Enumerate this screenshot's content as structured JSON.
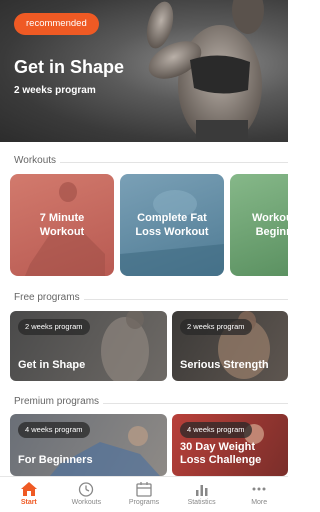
{
  "hero": {
    "badge": "recommended",
    "title": "Get in Shape",
    "subtitle": "2 weeks program"
  },
  "sections": {
    "workouts": "Workouts",
    "free": "Free programs",
    "premium": "Premium programs"
  },
  "workouts": [
    {
      "title": "7 Minute Workout",
      "color": "#c9675e"
    },
    {
      "title": "Complete Fat Loss Workout",
      "color": "#5f8aa3"
    },
    {
      "title": "Workout Beginn",
      "color": "#6fa371"
    }
  ],
  "free_programs": [
    {
      "badge": "2 weeks program",
      "title": "Get in Shape"
    },
    {
      "badge": "2 weeks program",
      "title": "Serious Strength"
    }
  ],
  "premium_programs": [
    {
      "badge": "4 weeks program",
      "title": "For Beginners"
    },
    {
      "badge": "4 weeks program",
      "title": "30 Day Weight Loss Challenge"
    }
  ],
  "nav": {
    "start": "Start",
    "workouts": "Workouts",
    "programs": "Programs",
    "statistics": "Statistics",
    "more": "More"
  },
  "colors": {
    "accent": "#ef5a24"
  }
}
